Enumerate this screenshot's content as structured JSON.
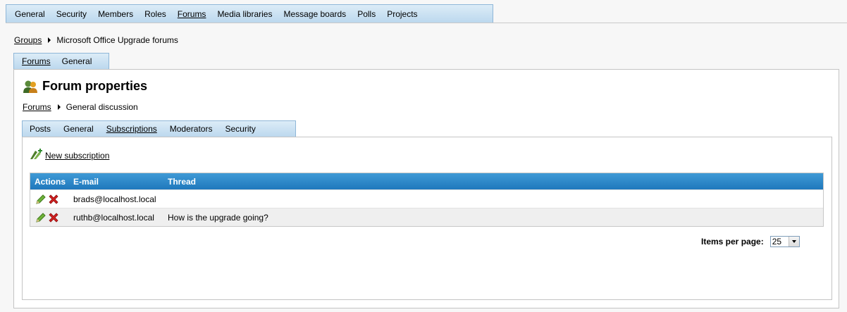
{
  "top_tabs": [
    "General",
    "Security",
    "Members",
    "Roles",
    "Forums",
    "Media libraries",
    "Message boards",
    "Polls",
    "Projects"
  ],
  "top_tabs_active": "Forums",
  "breadcrumb": {
    "link": "Groups",
    "current": "Microsoft Office Upgrade forums"
  },
  "sub_tabs": [
    "Forums",
    "General"
  ],
  "sub_tabs_active": "Forums",
  "heading": {
    "title": "Forum properties",
    "icon": "users-icon"
  },
  "breadcrumb2": {
    "link": "Forums",
    "current": "General discussion"
  },
  "inner_tabs": [
    "Posts",
    "General",
    "Subscriptions",
    "Moderators",
    "Security"
  ],
  "inner_tabs_active": "Subscriptions",
  "new_subscription": {
    "label": "New subscription",
    "icon": "add-subscription-icon"
  },
  "grid": {
    "columns": {
      "actions": "Actions",
      "email": "E-mail",
      "thread": "Thread"
    },
    "rows": [
      {
        "email": "brads@localhost.local",
        "thread": ""
      },
      {
        "email": "ruthb@localhost.local",
        "thread": "How is the upgrade going?"
      }
    ]
  },
  "pager": {
    "label": "Items per page:",
    "value": "25"
  },
  "colors": {
    "header_blue": "#1f78bc",
    "tab_bg": "#bcd8ee",
    "delete_red": "#d21f1f",
    "edit_green": "#5aa02c"
  }
}
